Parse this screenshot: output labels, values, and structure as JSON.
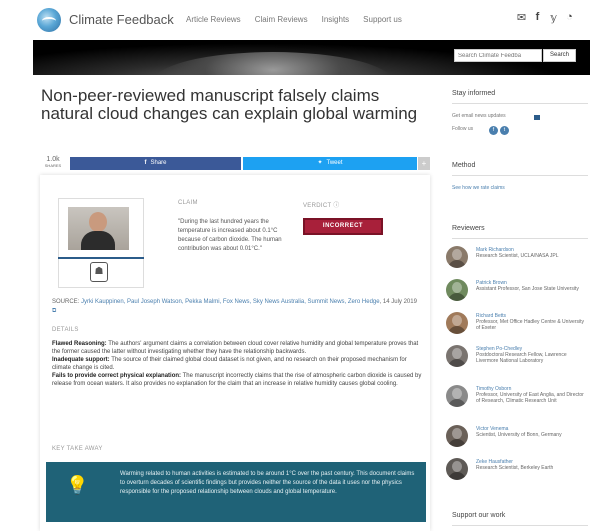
{
  "nav": {
    "brand": "Climate Feedback",
    "links": [
      "Article Reviews",
      "Claim Reviews",
      "Insights",
      "Support us"
    ],
    "icons": [
      "mail-icon",
      "facebook-icon",
      "twitter-icon",
      "rss-icon"
    ]
  },
  "search": {
    "placeholder": "Search Climate Feedba",
    "button": "Search"
  },
  "article": {
    "title": "Non-peer-reviewed manuscript falsely claims natural cloud changes can explain global warming"
  },
  "share": {
    "count": "1.0k",
    "count_label": "SHARES",
    "facebook": "Share",
    "twitter": "Tweet",
    "more": "+"
  },
  "claim": {
    "label": "CLAIM",
    "text": "\"During the last hundred years the temperature is increased about 0.1°C because of carbon dioxide. The human contribution was about 0.01°C.\"",
    "verdict_label": "VERDICT",
    "verdict": "INCORRECT"
  },
  "source": {
    "prefix": "SOURCE:",
    "authors": "Jyrki Kauppinen, Paul Joseph Watson, Pekka Malmi, Fox News, Sky News Australia, Summit News, Zero Hedge",
    "date": ", 14 July 2019"
  },
  "details": {
    "label": "DETAILS",
    "items": [
      {
        "term": "Flawed Reasoning:",
        "text": " The authors' argument claims a correlation between cloud cover relative humidity and global temperature proves that the former caused the latter without investigating whether they have the relationship backwards."
      },
      {
        "term": "Inadequate support:",
        "text": " The source of their claimed global cloud dataset is not given, and no research on their proposed mechanism for climate change is cited."
      },
      {
        "term": "Fails to provide correct physical explanation:",
        "text": " The manuscript incorrectly claims that the rise of atmospheric carbon dioxide is caused by release from ocean waters. It also provides no explanation for the claim that an increase in relative humidity causes global cooling."
      }
    ]
  },
  "takeaway": {
    "label": "KEY TAKE AWAY",
    "text": "Warming related to human activities is estimated to be around 1°C over the past century. This document claims to overturn decades of scientific findings but provides neither the source of the data it uses nor the physics responsible for the proposed relationship between clouds and global temperature."
  },
  "sidebar": {
    "stay_informed": {
      "heading": "Stay informed",
      "email_text": "Get email news updates",
      "follow_text": "Follow us"
    },
    "method": {
      "heading": "Method",
      "link": "See how we rate claims"
    },
    "reviewers": {
      "heading": "Reviewers",
      "items": [
        {
          "name": "Mark Richardson",
          "affiliation": "Research Scientist, UCLA/NASA JPL"
        },
        {
          "name": "Patrick Brown",
          "affiliation": "Assistant Professor, San Jose State University"
        },
        {
          "name": "Richard Betts",
          "affiliation": "Professor, Met Office Hadley Centre & University of Exeter"
        },
        {
          "name": "Stephen Po-Chedley",
          "affiliation": "Postdoctoral Research Fellow, Lawrence Livermore National Laboratory"
        },
        {
          "name": "Timothy Osborn",
          "affiliation": "Professor, University of East Anglia, and Director of Research, Climatic Research Unit"
        },
        {
          "name": "Victor Venema",
          "affiliation": "Scientist, University of Bonn, Germany"
        },
        {
          "name": "Zeke Hausfather",
          "affiliation": "Research Scientist, Berkeley Earth"
        }
      ]
    },
    "support": {
      "heading": "Support our work"
    }
  },
  "colors": {
    "facebook": "#3b5998",
    "twitter": "#1da1f2",
    "verdict": "#a8203a",
    "takeaway_bg": "#1f6277",
    "link": "#4a7fae"
  }
}
